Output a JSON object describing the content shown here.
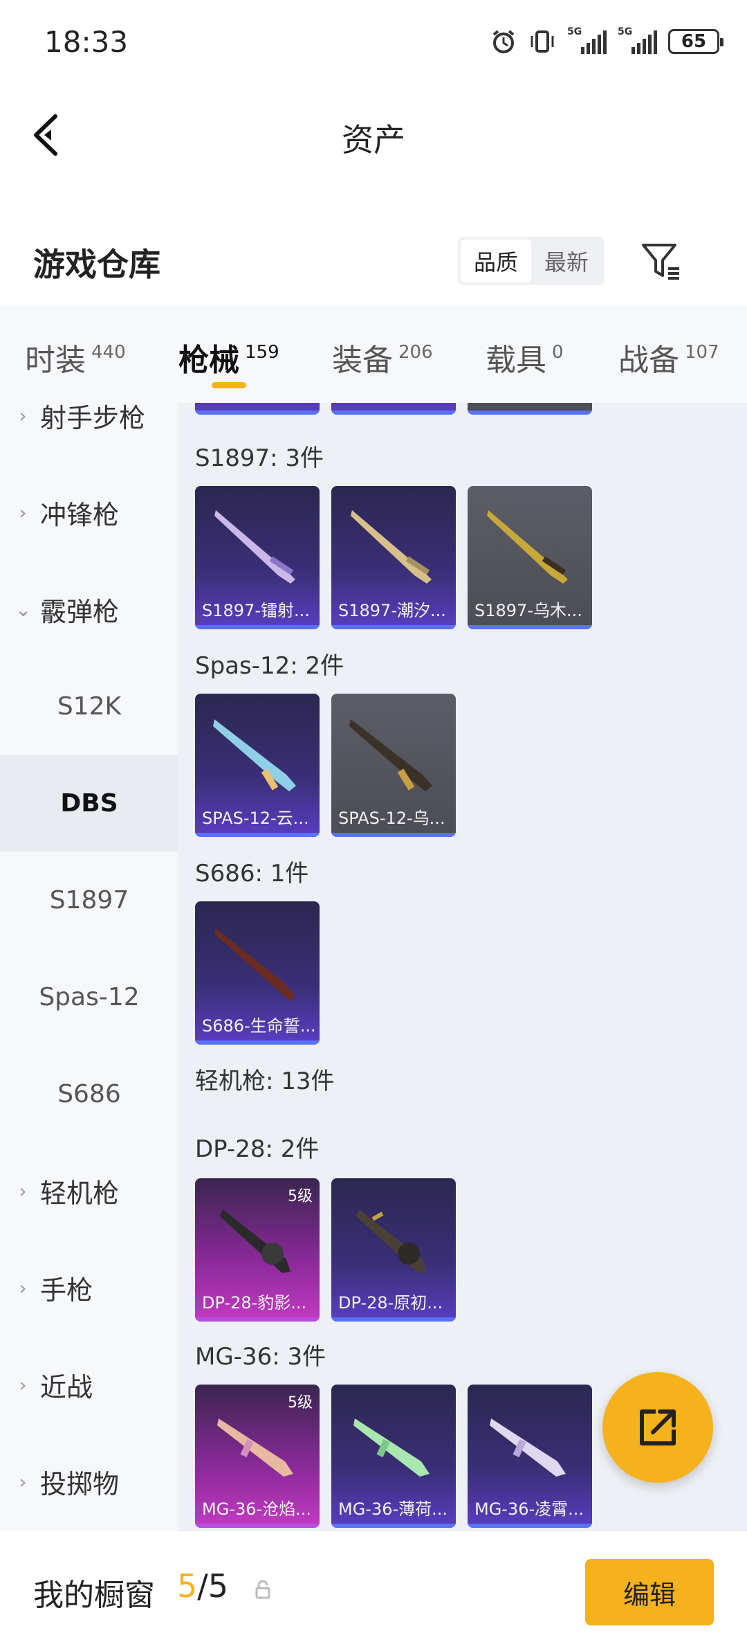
{
  "status_bar": {
    "time": "18:33",
    "battery": "65",
    "net1": "5G",
    "net2": "5G"
  },
  "header": {
    "title": "资产"
  },
  "warehouse": {
    "title": "游戏仓库",
    "sort_options": [
      "品质",
      "最新"
    ],
    "active_sort": "品质"
  },
  "tabs": [
    {
      "label": "时装",
      "count": "440"
    },
    {
      "label": "枪械",
      "count": "159"
    },
    {
      "label": "装备",
      "count": "206"
    },
    {
      "label": "载具",
      "count": "0"
    },
    {
      "label": "战备",
      "count": "107"
    }
  ],
  "active_tab": "枪械",
  "sidebar": {
    "items": [
      {
        "label": "射手步枪",
        "type": "category",
        "expanded": false
      },
      {
        "label": "冲锋枪",
        "type": "category",
        "expanded": false
      },
      {
        "label": "霰弹枪",
        "type": "category",
        "expanded": true
      },
      {
        "label": "S12K",
        "type": "sub"
      },
      {
        "label": "DBS",
        "type": "sub",
        "selected": true
      },
      {
        "label": "S1897",
        "type": "sub"
      },
      {
        "label": "Spas-12",
        "type": "sub"
      },
      {
        "label": "S686",
        "type": "sub"
      },
      {
        "label": "轻机枪",
        "type": "category",
        "expanded": false
      },
      {
        "label": "手枪",
        "type": "category",
        "expanded": false
      },
      {
        "label": "近战",
        "type": "category",
        "expanded": false
      },
      {
        "label": "投掷物",
        "type": "category",
        "expanded": false
      }
    ]
  },
  "groups": [
    {
      "label": "S1897: 3件",
      "items": [
        {
          "name": "S1897-镭射...",
          "rarity": "purple"
        },
        {
          "name": "S1897-潮汐...",
          "rarity": "purple"
        },
        {
          "name": "S1897-乌木...",
          "rarity": "grey"
        }
      ]
    },
    {
      "label": "Spas-12: 2件",
      "items": [
        {
          "name": "SPAS-12-云...",
          "rarity": "purple"
        },
        {
          "name": "SPAS-12-乌...",
          "rarity": "grey"
        }
      ]
    },
    {
      "label": "S686: 1件",
      "items": [
        {
          "name": "S686-生命誓...",
          "rarity": "purple"
        }
      ]
    },
    {
      "label": "轻机枪: 13件",
      "items": []
    },
    {
      "label": "DP-28: 2件",
      "items": [
        {
          "name": "DP-28-豹影...",
          "rarity": "pink",
          "level": "5级"
        },
        {
          "name": "DP-28-原初...",
          "rarity": "purple"
        }
      ]
    },
    {
      "label": "MG-36: 3件",
      "items": [
        {
          "name": "MG-36-沧焰...",
          "rarity": "pink",
          "level": "5级"
        },
        {
          "name": "MG-36-薄荷...",
          "rarity": "purple"
        },
        {
          "name": "MG-36-凌霄...",
          "rarity": "purple"
        }
      ]
    }
  ],
  "bottom_bar": {
    "label": "我的橱窗",
    "current": "5",
    "separator": "/",
    "total": "5",
    "edit_label": "编辑"
  },
  "colors": {
    "accent": "#f5b21c",
    "purple": "#3a2f78",
    "grey": "#55565e",
    "pink": "#c23bc2"
  }
}
